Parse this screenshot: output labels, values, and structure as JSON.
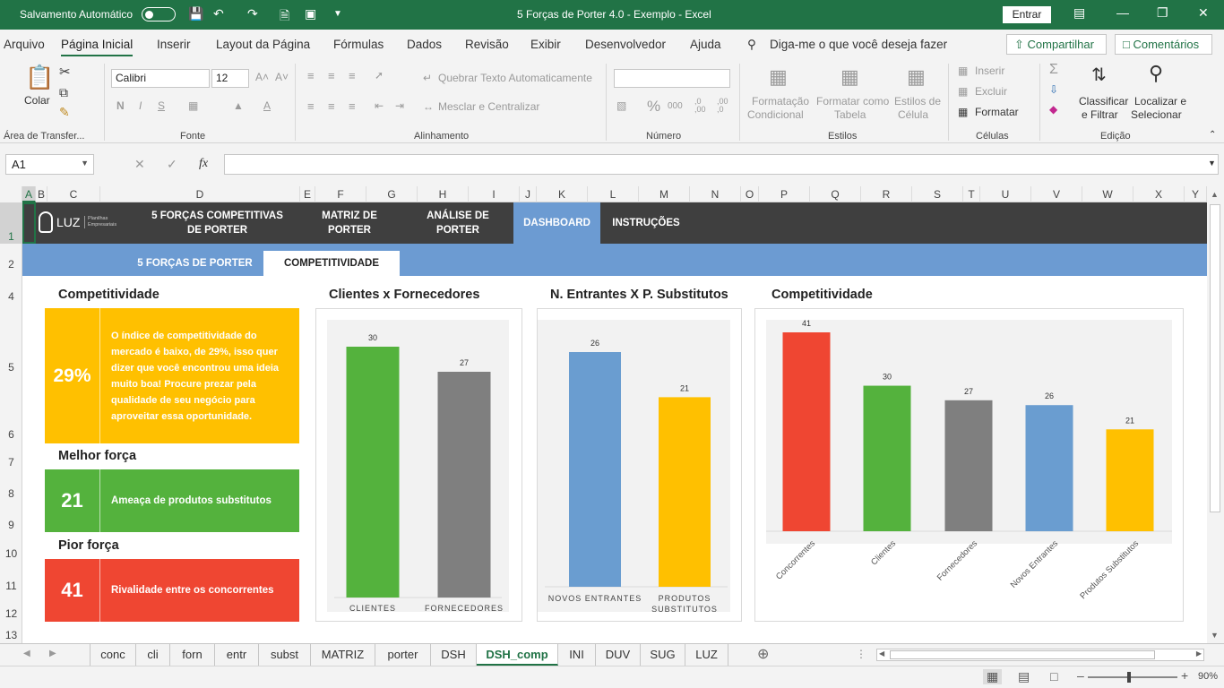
{
  "titlebar": {
    "autosave": "Salvamento Automático",
    "title": "5 Forças de Porter 4.0 - Exemplo  -  Excel",
    "signin": "Entrar"
  },
  "menu": {
    "items": [
      "Arquivo",
      "Página Inicial",
      "Inserir",
      "Layout da Página",
      "Fórmulas",
      "Dados",
      "Revisão",
      "Exibir",
      "Desenvolvedor",
      "Ajuda"
    ],
    "tell_me": "Diga-me o que você deseja fazer",
    "share": "Compartilhar",
    "comments": "Comentários"
  },
  "ribbon": {
    "paste": "Colar",
    "clipboard": "Área de Transfer...",
    "font_name": "Calibri",
    "font_size": "12",
    "font_group": "Fonte",
    "wrap": "Quebrar Texto Automaticamente",
    "merge": "Mesclar e Centralizar",
    "align_group": "Alinhamento",
    "number_group": "Número",
    "cond_fmt_1": "Formatação",
    "cond_fmt_2": "Condicional",
    "fmt_table_1": "Formatar como",
    "fmt_table_2": "Tabela",
    "cell_styles_1": "Estilos de",
    "cell_styles_2": "Célula",
    "styles_group": "Estilos",
    "insert": "Inserir",
    "delete": "Excluir",
    "format": "Formatar",
    "cells_group": "Células",
    "sort_1": "Classificar",
    "sort_2": "e Filtrar",
    "find_1": "Localizar e",
    "find_2": "Selecionar",
    "edit_group": "Edição"
  },
  "formula_bar": {
    "name_box": "A1",
    "fx": "fx",
    "value": ""
  },
  "columns": [
    "A",
    "B",
    "C",
    "D",
    "E",
    "F",
    "G",
    "H",
    "I",
    "J",
    "K",
    "L",
    "M",
    "N",
    "O",
    "P",
    "Q",
    "R",
    "S",
    "T",
    "U",
    "V",
    "W",
    "X",
    "Y"
  ],
  "rows": [
    "1",
    "2",
    "4",
    "5",
    "6",
    "7",
    "8",
    "9",
    "10",
    "11",
    "12",
    "13"
  ],
  "nav": {
    "logo": "LUZ",
    "logo_sub": "Planilhas Empresariais",
    "item1": "5 FORÇAS COMPETITIVAS DE PORTER",
    "item2": "MATRIZ DE PORTER",
    "item3": "ANÁLISE DE PORTER",
    "item4": "DASHBOARD",
    "item5": "INSTRUÇÕES",
    "sub1": "5 FORÇAS DE PORTER",
    "sub2": "COMPETITIVIDADE"
  },
  "kpis": {
    "competitividade_title": "Competitividade",
    "competitividade_value": "29%",
    "competitividade_text": "O índice de competitividade do mercado é baixo, de 29%, isso quer dizer que você encontrou uma ideia muito boa! Procure prezar pela qualidade de seu negócio para aproveitar essa oportunidade.",
    "melhor_title": "Melhor força",
    "melhor_value": "21",
    "melhor_text": "Ameaça de produtos substitutos",
    "pior_title": "Pior força",
    "pior_value": "41",
    "pior_text": "Rivalidade entre os concorrentes"
  },
  "colors": {
    "orange": "#ffc000",
    "green": "#54b23d",
    "gray": "#7f7f7f",
    "blue": "#6a9dd0",
    "red": "#ef4632",
    "excel": "#217346"
  },
  "chart_data": [
    {
      "type": "bar",
      "title": "Clientes x Fornecedores",
      "categories": [
        "CLIENTES",
        "FORNECEDORES"
      ],
      "values": [
        30,
        27
      ],
      "colors": [
        "#54b23d",
        "#7f7f7f"
      ],
      "ylim": [
        0,
        30
      ]
    },
    {
      "type": "bar",
      "title": "N. Entrantes X P. Substitutos",
      "categories": [
        "NOVOS ENTRANTES",
        "PRODUTOS SUBSTITUTOS"
      ],
      "values": [
        26,
        21
      ],
      "colors": [
        "#6a9dd0",
        "#ffc000"
      ],
      "ylim": [
        0,
        26
      ]
    },
    {
      "type": "bar",
      "title": "Competitividade",
      "categories": [
        "Concorrentes",
        "Clientes",
        "Fornecedores",
        "Novos Entrantes",
        "Produtos Substitutos"
      ],
      "values": [
        41,
        30,
        27,
        26,
        21
      ],
      "colors": [
        "#ef4632",
        "#54b23d",
        "#7f7f7f",
        "#6a9dd0",
        "#ffc000"
      ],
      "ylim": [
        0,
        41
      ]
    }
  ],
  "tabs": [
    "conc",
    "cli",
    "forn",
    "entr",
    "subst",
    "MATRIZ",
    "porter",
    "DSH",
    "DSH_comp",
    "INI",
    "DUV",
    "SUG",
    "LUZ"
  ],
  "active_tab": "DSH_comp",
  "status": {
    "zoom": "90%"
  }
}
